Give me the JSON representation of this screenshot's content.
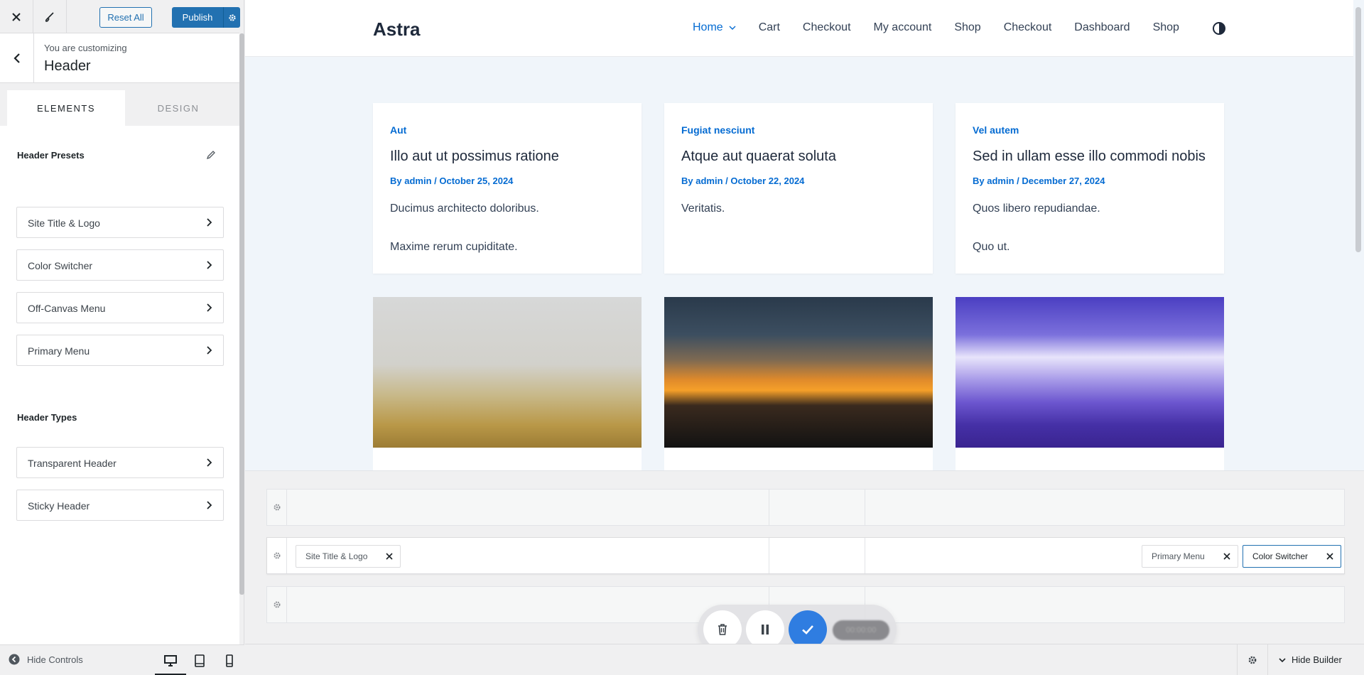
{
  "sidebar": {
    "reset_label": "Reset All",
    "publish_label": "Publish",
    "customizing_label": "You are customizing",
    "section_title": "Header",
    "tabs": [
      {
        "label": "ELEMENTS",
        "active": true
      },
      {
        "label": "DESIGN",
        "active": false
      }
    ],
    "presets_title": "Header Presets",
    "elements": [
      {
        "label": "Site Title & Logo"
      },
      {
        "label": "Color Switcher"
      },
      {
        "label": "Off-Canvas Menu"
      },
      {
        "label": "Primary Menu"
      }
    ],
    "types_title": "Header Types",
    "types": [
      {
        "label": "Transparent Header"
      },
      {
        "label": "Sticky Header"
      }
    ],
    "hide_controls_label": "Hide Controls",
    "devices": [
      "desktop-icon",
      "tablet-icon",
      "mobile-icon"
    ]
  },
  "site": {
    "title": "Astra",
    "nav": [
      "Home",
      "Cart",
      "Checkout",
      "My account",
      "Shop",
      "Checkout",
      "Dashboard",
      "Shop"
    ],
    "accent_color": "#046bd2"
  },
  "posts": [
    {
      "category": "Aut",
      "title": "Illo aut ut possimus ratione",
      "meta": "By admin / October 25, 2024",
      "excerpt1": "Ducimus architecto doloribus.",
      "excerpt2": "Maxime rerum cupiditate."
    },
    {
      "category": "Fugiat nesciunt",
      "title": "Atque aut quaerat soluta",
      "meta": "By admin / October 22, 2024",
      "excerpt1": "Veritatis.",
      "excerpt2": ""
    },
    {
      "category": "Vel autem",
      "title": "Sed in ullam esse illo commodi nobis",
      "meta": "By admin / December 27, 2024",
      "excerpt1": "Quos libero repudiandae.",
      "excerpt2": "Quo ut."
    }
  ],
  "builder": {
    "chips": {
      "site_title_logo": "Site Title & Logo",
      "primary_menu": "Primary Menu",
      "color_switcher": "Color Switcher"
    },
    "hide_builder_label": "Hide Builder",
    "timer": "00:00:00"
  },
  "colors": {
    "wp_blue": "#2271b1",
    "check_blue": "#2f7de1"
  }
}
